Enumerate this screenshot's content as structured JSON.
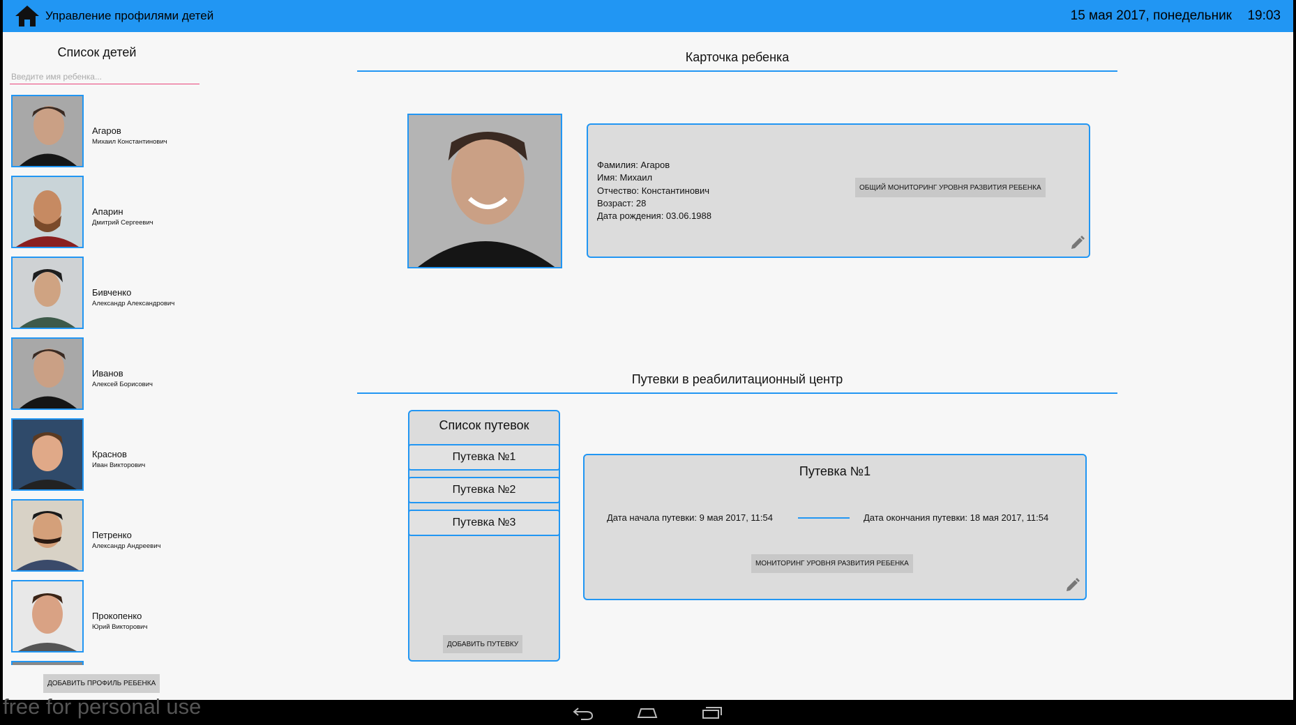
{
  "header": {
    "title": "Управление профилями детей",
    "date": "15 мая 2017, понедельник",
    "time": "19:03",
    "color": "#2196f3"
  },
  "sidebar": {
    "title": "Список детей",
    "search_placeholder": "Введите имя ребенка...",
    "children": [
      {
        "last_name": "Агаров",
        "first_name": "Михаил Константинович"
      },
      {
        "last_name": "Апарин",
        "first_name": "Дмитрий Сергеевич"
      },
      {
        "last_name": "Бивченко",
        "first_name": "Александр Александрович"
      },
      {
        "last_name": "Иванов",
        "first_name": "Алексей Борисович"
      },
      {
        "last_name": "Краснов",
        "first_name": "Иван Викторович"
      },
      {
        "last_name": "Петренко",
        "first_name": "Александр Андреевич"
      },
      {
        "last_name": "Прокопенко",
        "first_name": "Юрий Викторович"
      }
    ],
    "add_button": "ДОБАВИТЬ ПРОФИЛЬ РЕБЕНКА"
  },
  "card": {
    "title": "Карточка ребенка",
    "surname": "Фамилия: Агаров",
    "name": "Имя: Михаил",
    "patronymic": "Отчество: Константинович",
    "age": "Возраст: 28",
    "birth": "Дата рождения: 03.06.1988",
    "monitor_button": "ОБЩИЙ МОНИТОРИНГ УРОВНЯ РАЗВИТИЯ РЕБЕНКА"
  },
  "trips": {
    "section_title": "Путевки в реабилитационный центр",
    "list_title": "Список путевок",
    "items": [
      "Путевка №1",
      "Путевка №2",
      "Путевка №3"
    ],
    "add_button": "ДОБАВИТЬ ПУТЕВКУ",
    "selected": {
      "title": "Путевка №1",
      "start": "Дата начала путевки: 9 мая 2017, 11:54",
      "end": "Дата окончания путевки: 18 мая 2017, 11:54",
      "monitor_button": "МОНИТОРИНГ УРОВНЯ РАЗВИТИЯ РЕБЕНКА"
    }
  },
  "watermark": "free for personal use",
  "navbar": {
    "icons": [
      "back-icon",
      "home-nav-icon",
      "recents-icon"
    ]
  }
}
